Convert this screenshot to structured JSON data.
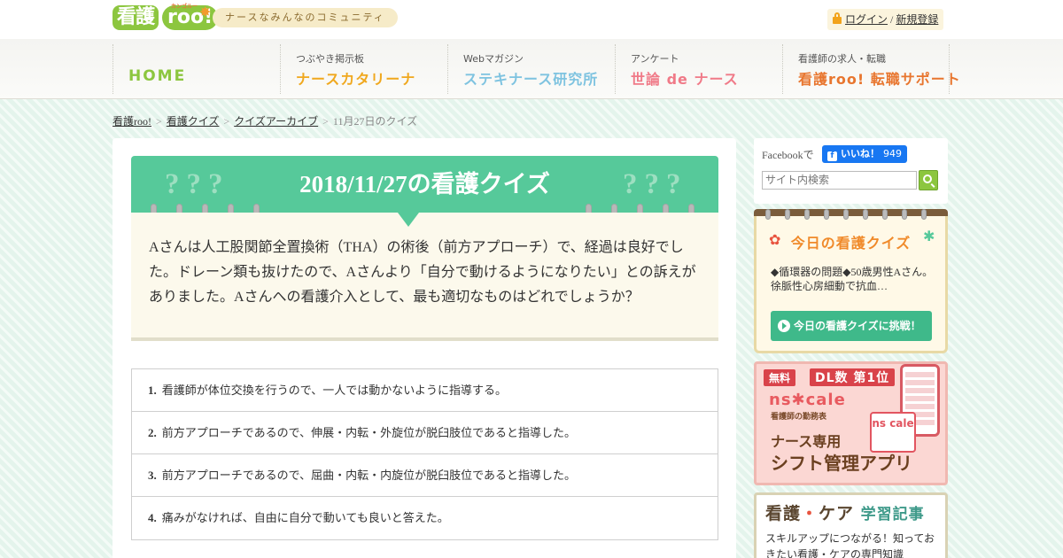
{
  "header": {
    "logo_kanji": "看護",
    "logo_roo": "roo!",
    "logo_small": "カンゴルー",
    "tagline": "ナースなみんなのコミュニティ",
    "login": "ログイン",
    "separator": "/",
    "register": "新規登録"
  },
  "nav": [
    {
      "sub": "",
      "main": "HOME",
      "color": "#8cc63f"
    },
    {
      "sub": "つぶやき掲示板",
      "main": "ナースカタリーナ",
      "color": "#f0a81e"
    },
    {
      "sub": "Webマガジン",
      "main": "ステキナース研究所",
      "color": "#7ec3e0"
    },
    {
      "sub": "アンケート",
      "main": "世論 de ナース",
      "color": "#f07a88"
    },
    {
      "sub": "看護師の求人・転職",
      "main": "看護roo! 転職サポート",
      "color": "#e8762f"
    }
  ],
  "breadcrumb": {
    "items": [
      "看護roo!",
      "看護クイズ",
      "クイズアーカイブ"
    ],
    "current": "11月27日のクイズ",
    "sep": ">"
  },
  "quiz": {
    "marks": "???",
    "title": "2018/11/27の看護クイズ",
    "question": "Aさんは人工股関節全置換術（THA）の術後（前方アプローチ）で、経過は良好でした。ドレーン類も抜けたので、Aさんより「自分で動けるようになりたい」との訴えがありました。Aさんへの看護介入として、最も適切なものはどれでしょうか？",
    "choices": [
      {
        "num": "1.",
        "text": "看護師が体位交換を行うので、一人では動かないように指導する。"
      },
      {
        "num": "2.",
        "text": "前方アプローチであるので、伸展・内転・外旋位が脱臼肢位であると指導した。"
      },
      {
        "num": "3.",
        "text": "前方アプローチであるので、屈曲・内転・内旋位が脱臼肢位であると指導した。"
      },
      {
        "num": "4.",
        "text": "痛みがなければ、自由に自分で動いても良いと答えた。"
      }
    ]
  },
  "sidebar": {
    "fb_label": "Facebookで",
    "fb_icon": "f",
    "fb_like": "いいね！",
    "fb_count": "949",
    "search_placeholder": "サイト内検索",
    "today_title": "今日の看護クイズ",
    "today_text": "◆循環器の問題◆50歳男性Aさん。徐脈性心房細動で抗血…",
    "today_button": "今日の看護クイズに挑戦！",
    "nscale_badge": "無料",
    "nscale_dl": "DL数 第1位",
    "nscale_brand": "ns✱cale",
    "nscale_brandsub": "看護師の勤務表",
    "nscale_line1": "ナース専用",
    "nscale_line2": "シフト管理アプリ",
    "nscale_cal": "ns cale",
    "learn_title_a": "看護",
    "learn_title_dot": "・",
    "learn_title_b": "ケア",
    "learn_title_c": "学習記事",
    "learn_text": "スキルアップにつながる！知っておきたい看護・ケアの専門知識"
  },
  "colors": {
    "accent_green": "#56c99a",
    "brand_green": "#8cc63f",
    "orange": "#f08a2a"
  }
}
